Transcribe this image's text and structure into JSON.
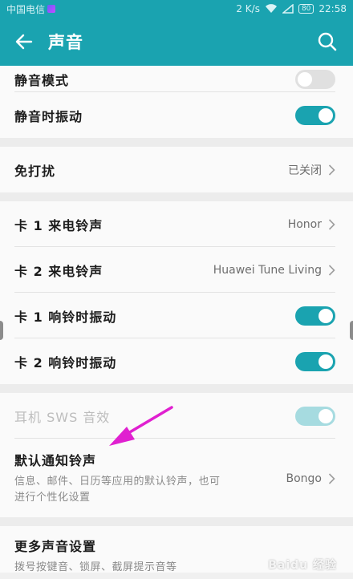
{
  "status_bar": {
    "carrier": "中国电信",
    "speed": "2 K/s",
    "battery": "80",
    "time": "22:58"
  },
  "app_bar": {
    "title": "声音",
    "back_icon": "back-arrow-icon",
    "search_icon": "search-icon"
  },
  "settings": {
    "silent_mode": {
      "label": "静音模式",
      "on": false
    },
    "vibrate_silent": {
      "label": "静音时振动",
      "on": true
    },
    "dnd": {
      "label": "免打扰",
      "value": "已关闭"
    },
    "sim1_ringtone": {
      "label": "卡 1 来电铃声",
      "value": "Honor"
    },
    "sim2_ringtone": {
      "label": "卡 2 来电铃声",
      "value": "Huawei Tune Living"
    },
    "sim1_vibrate": {
      "label": "卡 1 响铃时振动",
      "on": true
    },
    "sim2_vibrate": {
      "label": "卡 2 响铃时振动",
      "on": true
    },
    "sws": {
      "label": "耳机 SWS 音效",
      "on": true,
      "disabled": true
    },
    "notification": {
      "label": "默认通知铃声",
      "desc": "信息、邮件、日历等应用的默认铃声，也可进行个性化设置",
      "value": "Bongo"
    },
    "more": {
      "label": "更多声音设置",
      "desc": "拨号按键音、锁屏、截屏提示音等"
    }
  },
  "watermark": "Baidu 经验",
  "colors": {
    "accent": "#1aa3b0",
    "annotation_arrow": "#e020d0"
  }
}
